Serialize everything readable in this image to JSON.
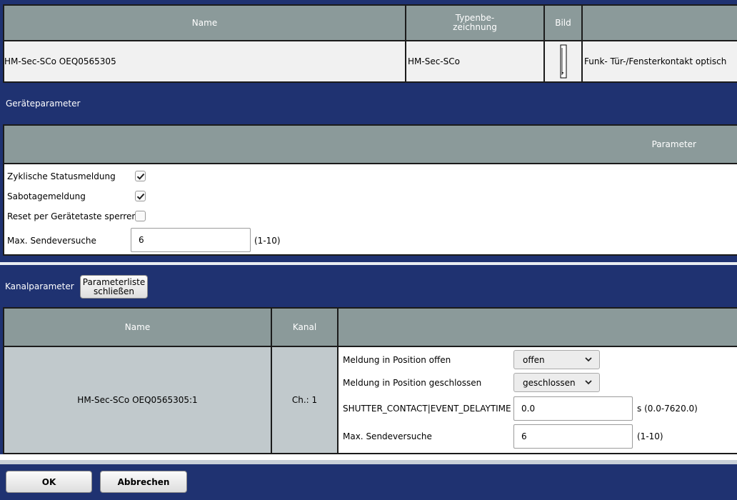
{
  "device_table": {
    "headers": {
      "name": "Name",
      "type_line1": "Typenbe-",
      "type_line2": "zeichnung",
      "image": "Bild",
      "description": ""
    },
    "row": {
      "name": "HM-Sec-SCo OEQ0565305",
      "type": "HM-Sec-SCo",
      "description": "Funk- Tür-/Fensterkontakt optisch"
    }
  },
  "device_params": {
    "section_title": "Geräteparameter",
    "header_label": "Parameter",
    "cyclic_status": {
      "label": "Zyklische Statusmeldung",
      "checked": true
    },
    "sabotage": {
      "label": "Sabotagemeldung",
      "checked": true
    },
    "reset_lock": {
      "label": "Reset per Gerätetaste sperren",
      "checked": false
    },
    "max_send": {
      "label": "Max. Sendeversuche",
      "value": "6",
      "range": "(1-10)"
    }
  },
  "channel_params": {
    "section_title": "Kanalparameter",
    "close_button_line1": "Parameterliste",
    "close_button_line2": "schließen",
    "headers": {
      "name": "Name",
      "channel": "Kanal"
    },
    "row": {
      "name": "HM-Sec-SCo OEQ0565305:1",
      "channel": "Ch.: 1",
      "msg_open": {
        "label": "Meldung in Position offen",
        "value": "offen"
      },
      "msg_closed": {
        "label": "Meldung in Position geschlossen",
        "value": "geschlossen"
      },
      "delay": {
        "label": "SHUTTER_CONTACT|EVENT_DELAYTIME",
        "value": "0.0",
        "range": "s (0.0-7620.0)"
      },
      "max_send": {
        "label": "Max. Sendeversuche",
        "value": "6",
        "range": "(1-10)"
      }
    }
  },
  "footer": {
    "ok": "OK",
    "cancel": "Abbrechen"
  },
  "icons": {
    "checkbox_checked": "checkmark-icon",
    "dropdown": "chevron-down-icon",
    "device_image": "door-window-sensor-icon"
  },
  "colors": {
    "navy": "#1f3271",
    "header_gray": "#8b9a9a",
    "channel_name_bg": "#c1c9cc"
  }
}
